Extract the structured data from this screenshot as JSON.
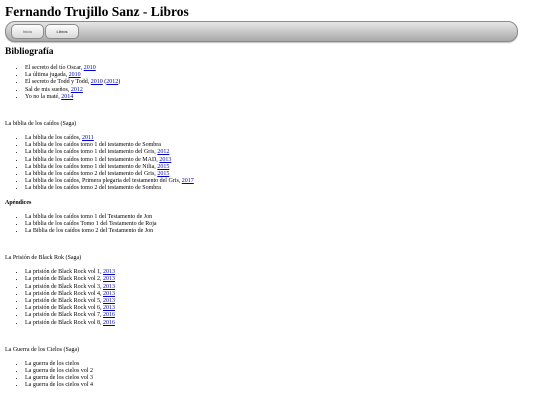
{
  "site_title": "Fernando Trujillo Sanz - Libros",
  "nav": {
    "inicio": "Inicio",
    "libros": "Libros"
  },
  "section_title": "Bibliografía",
  "standalone_books": [
    {
      "title": "El secreto del tío Oscar, ",
      "years": [
        "2010"
      ]
    },
    {
      "title": "La última jugada, ",
      "years": [
        "2010"
      ]
    },
    {
      "title": "El secreto de Todd y Todd, ",
      "years": [
        "2010",
        "2012"
      ]
    },
    {
      "title": "Sal de mis sueños, ",
      "years": [
        "2012"
      ]
    },
    {
      "title": "Yo no la maté, ",
      "years": [
        "2014"
      ]
    }
  ],
  "saga_caidos": {
    "title": "La biblia de los caídos (Saga)",
    "books": [
      {
        "title": "La biblia de los caídos, ",
        "year": "2011"
      },
      {
        "title": "La biblia de los caídos tomo 1 del testamento de Sombra",
        "year": ""
      },
      {
        "title": "La biblia de los caídos tomo 1 del testamento del Gris, ",
        "year": "2012"
      },
      {
        "title": "La biblia de los caídos tomo 1 del testamento de MAD, ",
        "year": "2013"
      },
      {
        "title": "La biblia de los caídos tomo 1 del testamento de Nilia, ",
        "year": "2015"
      },
      {
        "title": "La biblia de los caídos tomo 2 del testamento del Gris, ",
        "year": "2015"
      },
      {
        "title": "La biblia de los caídos, Primera plegaria del testamento del Gris, ",
        "year": "2017"
      },
      {
        "title": "La biblia de los caídos tomo 2 del testamento de Sombra",
        "year": ""
      }
    ],
    "appendix_title": "Apéndices",
    "appendices": [
      "La biblia de los caídos tomo 1 del Testamento de Jon",
      "La biblia de los caídos Tomo 1 del Testamento de Roja",
      "La Biblia de los caídos tomo 2 del Testamento de Jon"
    ]
  },
  "saga_black_rock": {
    "title": "La Prisión de Black Rok (Saga)",
    "books": [
      {
        "title": "La prisión de Black Rock vol 1, ",
        "year": "2013"
      },
      {
        "title": "La prisión de Black Rock vol 2, ",
        "year": "2013"
      },
      {
        "title": "La prisión de Black Rock vol 3, ",
        "year": "2013"
      },
      {
        "title": "La prisión de Black Rock vol 4, ",
        "year": "2013"
      },
      {
        "title": "La prisión de Black Rock vol 5, ",
        "year": "2013"
      },
      {
        "title": "La prisión de Black Rock vol 6, ",
        "year": "2013"
      },
      {
        "title": "La prisión de Black Rock vol 7, ",
        "year": "2016"
      },
      {
        "title": "La prisión de Black Rock vol 8, ",
        "year": "2016"
      }
    ]
  },
  "saga_cielos": {
    "title": "La Guerra de los Cielos (Saga)",
    "books": [
      "La guerra de los cielos",
      "La guerra de los cielos vol 2",
      "La guerra de los cielos vol 3",
      "La guerra de los cielos vol 4"
    ]
  }
}
